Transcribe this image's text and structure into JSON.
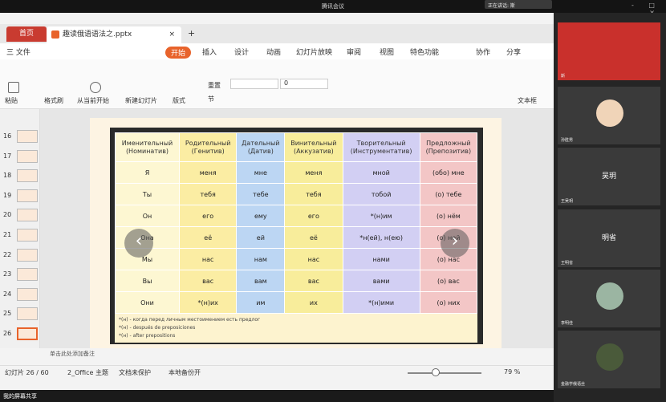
{
  "meeting": {
    "title": "腾讯会议",
    "speaking": "正在讲话: 斯",
    "watermark": "- □ ×"
  },
  "tabs": {
    "home": "首页",
    "file": "趣读俄语语法之.pptx",
    "close": "×",
    "add": "+"
  },
  "menu": {
    "file": "三 文件",
    "start": "开始",
    "insert": "插入",
    "design": "设计",
    "animation": "动画",
    "slideshow": "幻灯片放映",
    "review": "审阅",
    "view": "视图",
    "special": "特色功能",
    "collab": "协作",
    "share": "分享"
  },
  "ribbon": {
    "paste": "粘贴",
    "format_painter": "格式刷",
    "from_current": "从当前开始",
    "new_slide": "新建幻灯片",
    "layout": "版式",
    "section": "节",
    "reset": "重置",
    "font_size": "0",
    "text_box": "文本框"
  },
  "slides": [
    {
      "num": "16"
    },
    {
      "num": "17"
    },
    {
      "num": "18"
    },
    {
      "num": "19"
    },
    {
      "num": "20"
    },
    {
      "num": "21"
    },
    {
      "num": "22"
    },
    {
      "num": "23"
    },
    {
      "num": "24"
    },
    {
      "num": "25"
    },
    {
      "num": "26"
    }
  ],
  "table": {
    "headers": [
      [
        "Именительный",
        "(Номинатив)"
      ],
      [
        "Родительный",
        "(Генитив)"
      ],
      [
        "Дательный",
        "(Датив)"
      ],
      [
        "Винительный",
        "(Аккузатив)"
      ],
      [
        "Творительный",
        "(Инструментатив)"
      ],
      [
        "Предложный",
        "(Препозитив)"
      ]
    ],
    "rows": [
      [
        "Я",
        "меня",
        "мне",
        "меня",
        "мной",
        "(обо) мне"
      ],
      [
        "Ты",
        "тебя",
        "тебе",
        "тебя",
        "тобой",
        "(о) тебе"
      ],
      [
        "Он",
        "его",
        "ему",
        "его",
        "*(н)им",
        "(о) нём"
      ],
      [
        "Она",
        "её",
        "ей",
        "её",
        "*н(ей), н(ею)",
        "(о) ней"
      ],
      [
        "Мы",
        "нас",
        "нам",
        "нас",
        "нами",
        "(о) нас"
      ],
      [
        "Вы",
        "вас",
        "вам",
        "вас",
        "вами",
        "(о) вас"
      ],
      [
        "Они",
        "*(н)их",
        "им",
        "их",
        "*(н)ими",
        "(о) них"
      ]
    ],
    "notes": [
      "*(н) - когда перед личным местоимением есть предлог",
      "*(н) - después de preposiciones",
      "*(н) - after prepositions"
    ]
  },
  "nav": {
    "prev": "‹",
    "next": "›"
  },
  "notebar": {
    "text": "单击此处添加备注"
  },
  "status": {
    "slide": "幻灯片 26 / 60",
    "theme": "2_Office 主题",
    "protect": "文档未保护",
    "backup": "本地备份开",
    "zoom": "79 %"
  },
  "taskbar": {
    "share": "我的屏幕共享"
  },
  "participants": [
    {
      "name": "斯"
    },
    {
      "name": "孙胜男"
    },
    {
      "display": "吴玥",
      "name": "王吴玥"
    },
    {
      "display": "明省",
      "name": "王明省"
    },
    {
      "name": "李明佳"
    },
    {
      "name": "金融学俄语丝"
    }
  ]
}
